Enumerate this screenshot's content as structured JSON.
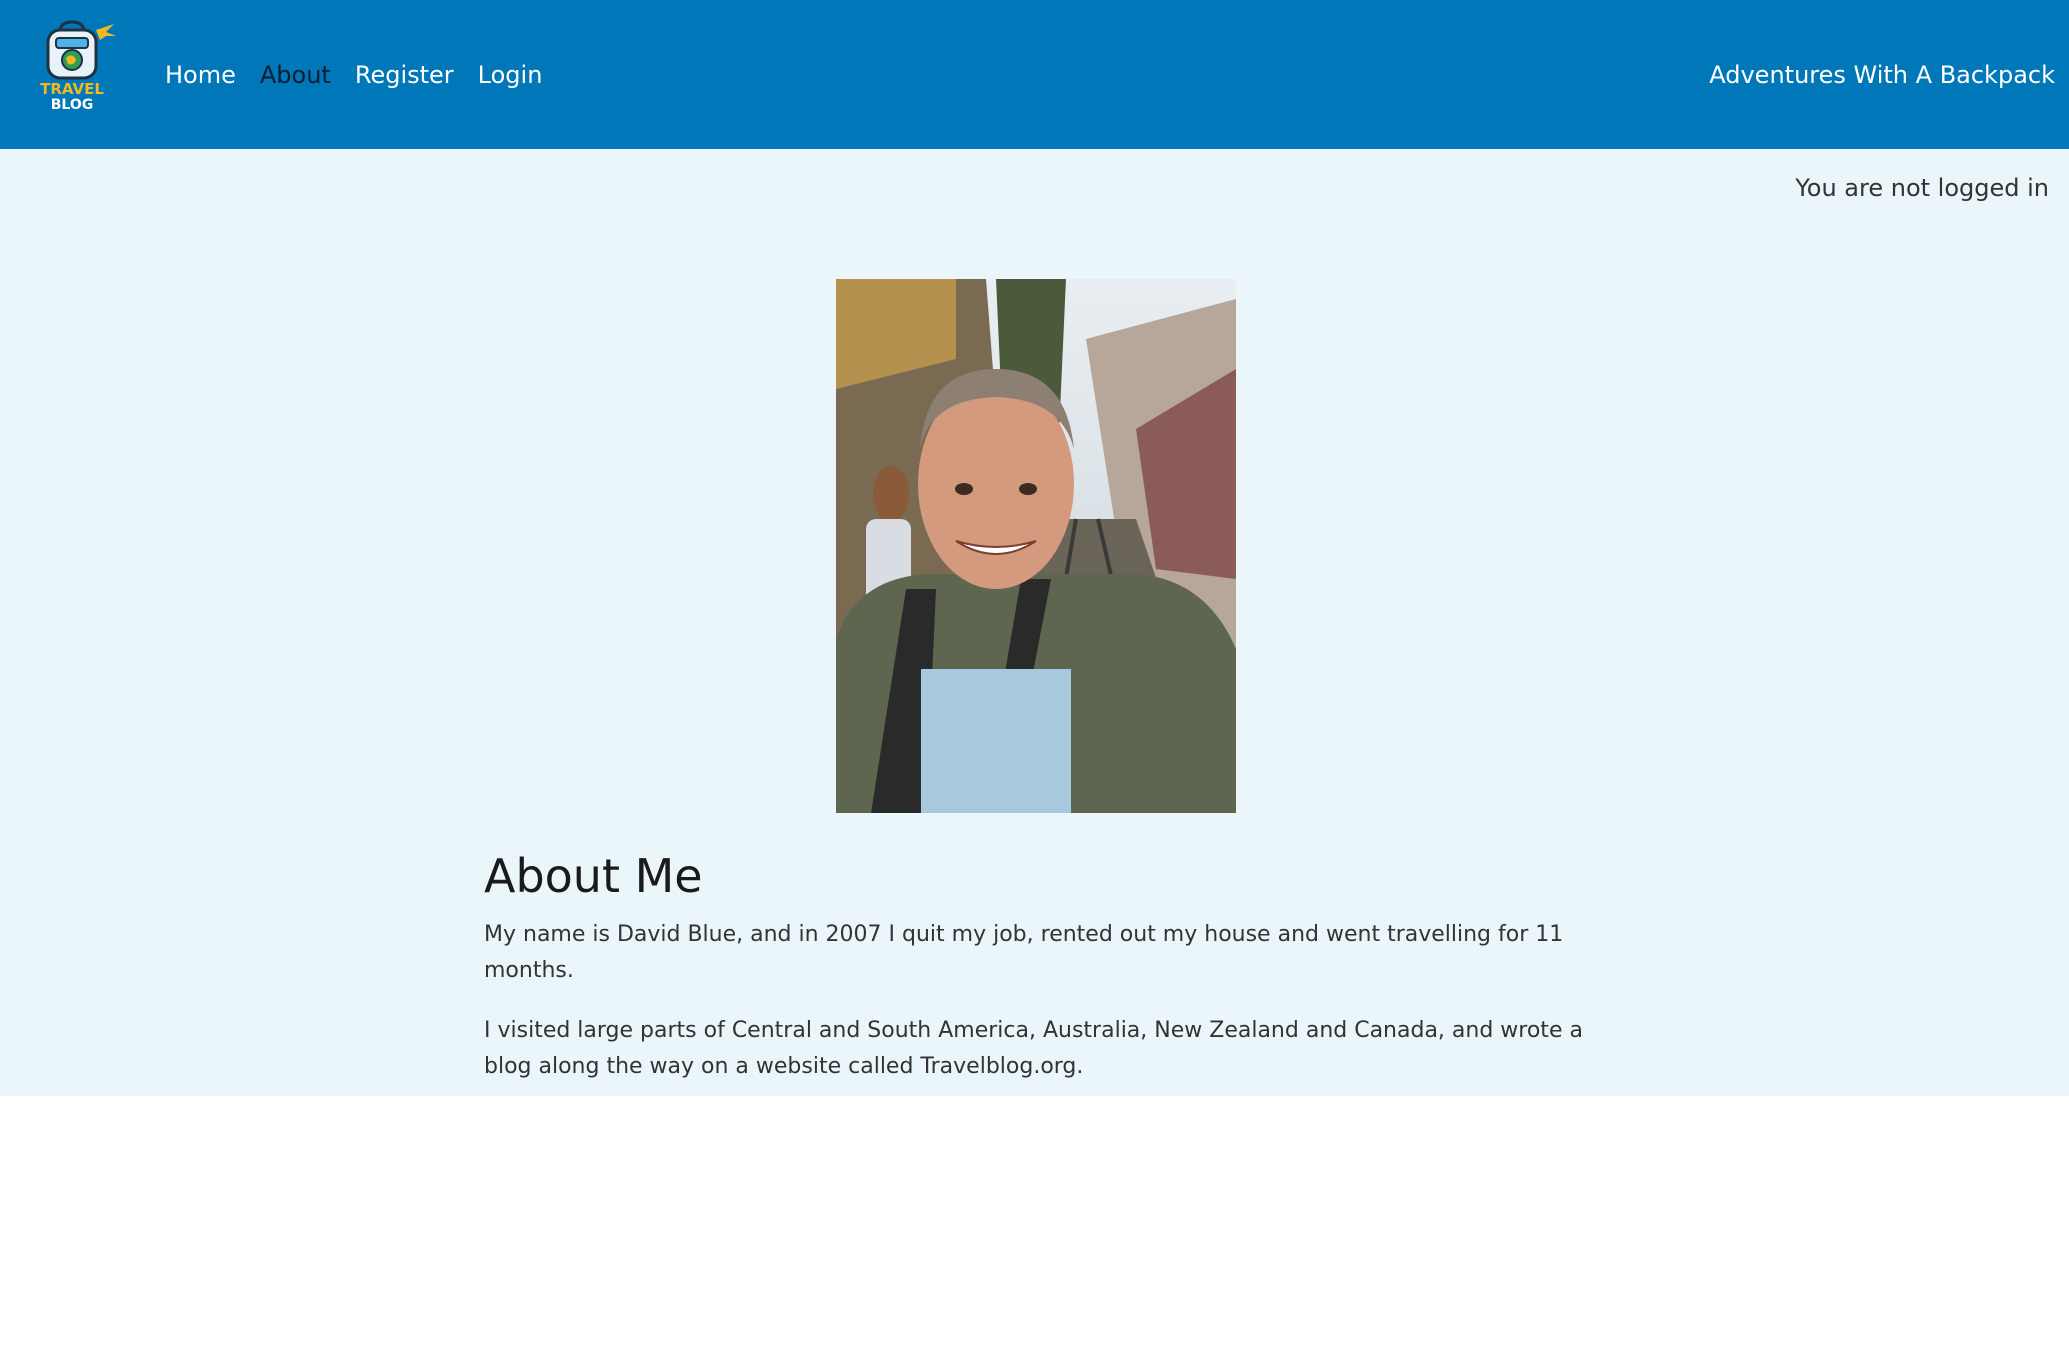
{
  "header": {
    "logo": {
      "icon": "backpack-logo-icon",
      "line1": "TRAVEL",
      "line2": "BLOG"
    },
    "nav": [
      {
        "label": "Home",
        "active": false
      },
      {
        "label": "About",
        "active": true
      },
      {
        "label": "Register",
        "active": false
      },
      {
        "label": "Login",
        "active": false
      }
    ],
    "brand": "Adventures With A Backpack"
  },
  "status": {
    "login_text": "You are not logged in"
  },
  "main": {
    "photo": {
      "icon": "profile-photo"
    },
    "title": "About Me",
    "paragraphs": [
      "My name is David Blue, and in 2007 I quit my job, rented out my house and went travelling for 11 months.",
      "I visited large parts of Central and South America, Australia, New Zealand and Canada, and wrote a blog along the way on a website called Travelblog.org."
    ]
  },
  "colors": {
    "navbar": "#0077b8",
    "content_bg": "#ebf6fa",
    "active_nav": "#0c1e33"
  }
}
